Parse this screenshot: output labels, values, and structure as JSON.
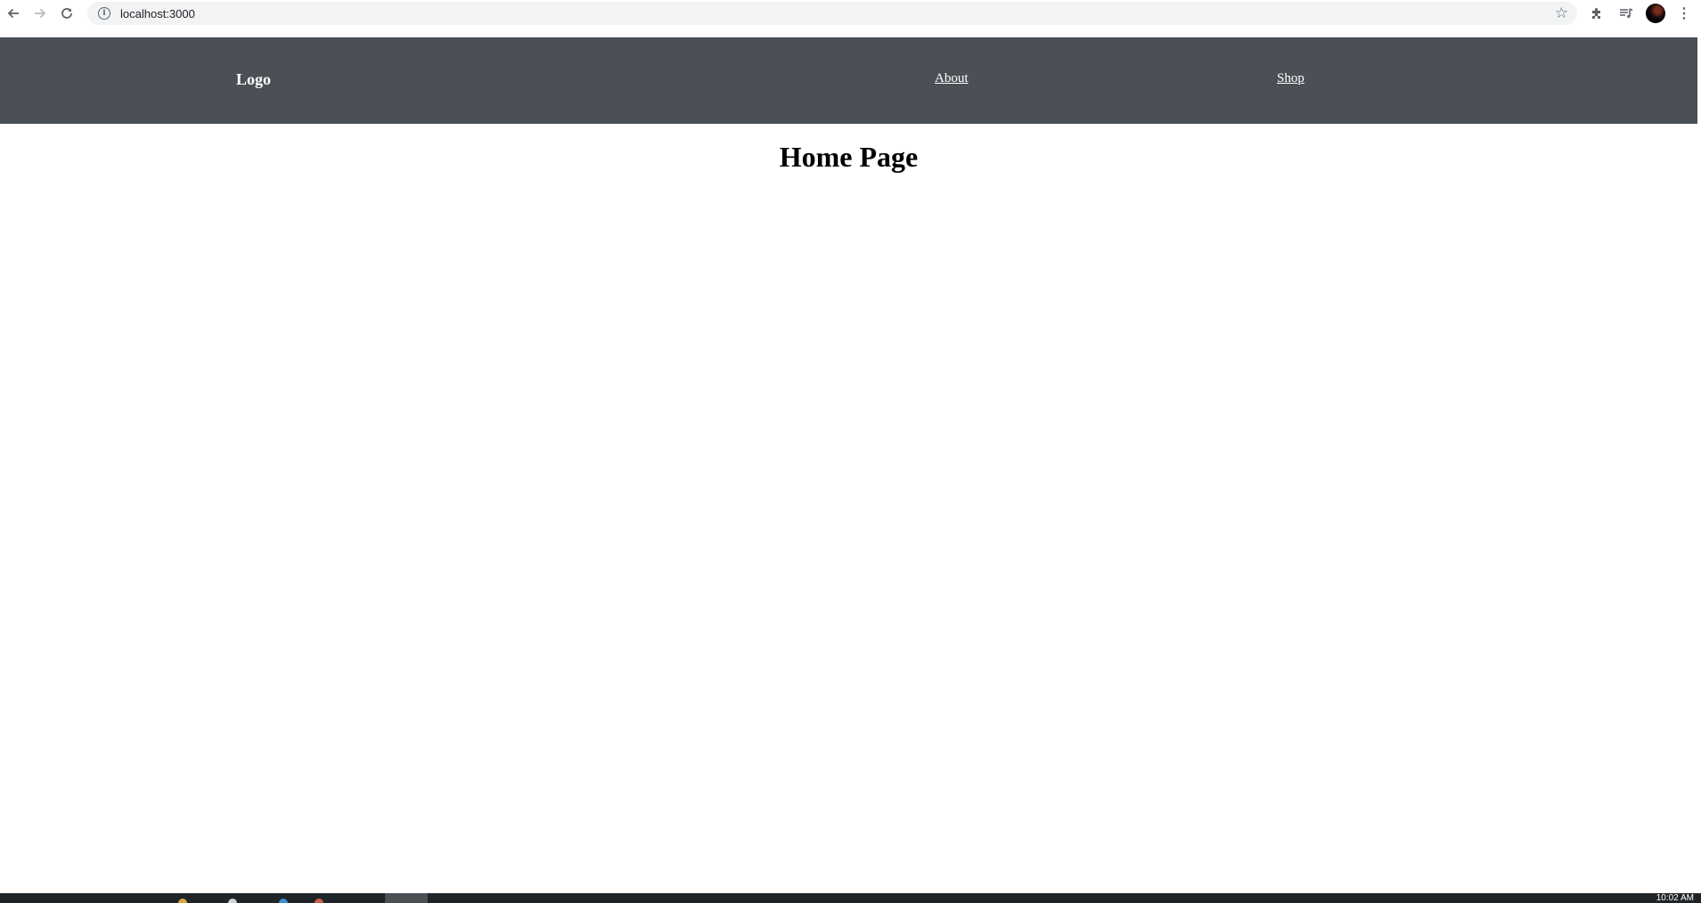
{
  "browser": {
    "url": "localhost:3000",
    "icons": {
      "back": "arrow-left",
      "forward": "arrow-right",
      "reload": "reload",
      "site_info": "info",
      "bookmark": "star",
      "extensions": "puzzle",
      "media": "media-queue",
      "profile": "avatar",
      "menu": "kebab-menu"
    }
  },
  "header": {
    "logo": "Logo",
    "nav": [
      {
        "label": "About"
      },
      {
        "label": "Shop"
      }
    ],
    "background": "#4a5055"
  },
  "main": {
    "title": "Home Page"
  },
  "taskbar": {
    "time": "10:02 AM"
  }
}
